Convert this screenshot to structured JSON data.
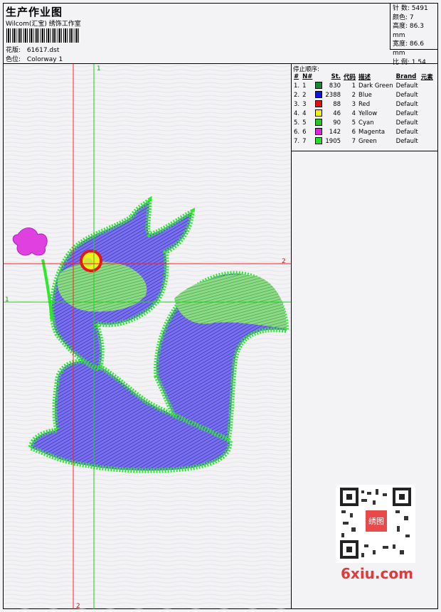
{
  "header": {
    "title": "生产作业图",
    "subtitle": "Wilcom(汇宝) 绣饰工作室",
    "design_file_label": "花版:",
    "design_file": "61617.dst",
    "colorway_label": "色位:",
    "colorway": "Colorway 1"
  },
  "stats": {
    "stitches_label": "针 数:",
    "stitches": "5491",
    "colors_label": "颜色:",
    "colors": "7",
    "height_label": "高度:",
    "height": "86.3 mm",
    "width_label": "宽度:",
    "width": "86.6 mm",
    "scale_label": "比 例:",
    "scale": "1.54"
  },
  "stop_sequence": {
    "heading": "停止顺序:",
    "columns": [
      "#",
      "N#",
      "St.",
      "代码",
      "描述",
      "Brand",
      "元素"
    ],
    "rows": [
      {
        "idx": "1.",
        "n": "1",
        "color": "#138a2e",
        "st": "830",
        "code": "1",
        "desc": "Dark Green",
        "brand": "Default"
      },
      {
        "idx": "2.",
        "n": "2",
        "color": "#1010e0",
        "st": "2388",
        "code": "2",
        "desc": "Blue",
        "brand": "Default"
      },
      {
        "idx": "3.",
        "n": "3",
        "color": "#e01010",
        "st": "88",
        "code": "3",
        "desc": "Red",
        "brand": "Default"
      },
      {
        "idx": "4.",
        "n": "4",
        "color": "#f0f000",
        "st": "46",
        "code": "4",
        "desc": "Yellow",
        "brand": "Default"
      },
      {
        "idx": "5.",
        "n": "5",
        "color": "#22c822",
        "st": "90",
        "code": "5",
        "desc": "Cyan",
        "brand": "Default"
      },
      {
        "idx": "6.",
        "n": "6",
        "color": "#e020e0",
        "st": "142",
        "code": "6",
        "desc": "Magenta",
        "brand": "Default"
      },
      {
        "idx": "7.",
        "n": "7",
        "color": "#20e020",
        "st": "1905",
        "code": "7",
        "desc": "Green",
        "brand": "Default"
      }
    ]
  },
  "guides": {
    "v1": "1",
    "v2": "2",
    "h1": "1",
    "h2": "2"
  },
  "watermark": {
    "qr_stamp": "绣图",
    "logo": "6xiu.com"
  }
}
